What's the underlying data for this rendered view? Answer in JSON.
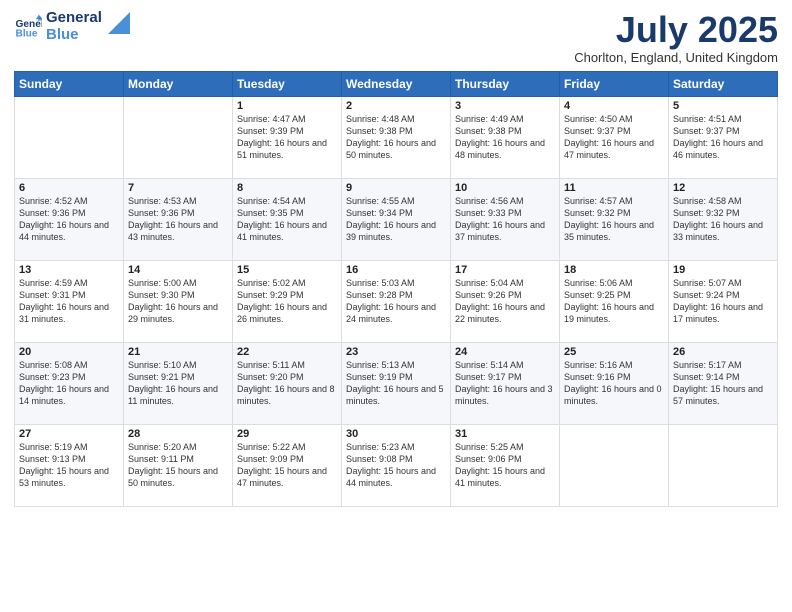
{
  "logo": {
    "line1": "General",
    "line2": "Blue"
  },
  "title": "July 2025",
  "subtitle": "Chorlton, England, United Kingdom",
  "days_of_week": [
    "Sunday",
    "Monday",
    "Tuesday",
    "Wednesday",
    "Thursday",
    "Friday",
    "Saturday"
  ],
  "weeks": [
    [
      {
        "day": "",
        "sunrise": "",
        "sunset": "",
        "daylight": ""
      },
      {
        "day": "",
        "sunrise": "",
        "sunset": "",
        "daylight": ""
      },
      {
        "day": "1",
        "sunrise": "Sunrise: 4:47 AM",
        "sunset": "Sunset: 9:39 PM",
        "daylight": "Daylight: 16 hours and 51 minutes."
      },
      {
        "day": "2",
        "sunrise": "Sunrise: 4:48 AM",
        "sunset": "Sunset: 9:38 PM",
        "daylight": "Daylight: 16 hours and 50 minutes."
      },
      {
        "day": "3",
        "sunrise": "Sunrise: 4:49 AM",
        "sunset": "Sunset: 9:38 PM",
        "daylight": "Daylight: 16 hours and 48 minutes."
      },
      {
        "day": "4",
        "sunrise": "Sunrise: 4:50 AM",
        "sunset": "Sunset: 9:37 PM",
        "daylight": "Daylight: 16 hours and 47 minutes."
      },
      {
        "day": "5",
        "sunrise": "Sunrise: 4:51 AM",
        "sunset": "Sunset: 9:37 PM",
        "daylight": "Daylight: 16 hours and 46 minutes."
      }
    ],
    [
      {
        "day": "6",
        "sunrise": "Sunrise: 4:52 AM",
        "sunset": "Sunset: 9:36 PM",
        "daylight": "Daylight: 16 hours and 44 minutes."
      },
      {
        "day": "7",
        "sunrise": "Sunrise: 4:53 AM",
        "sunset": "Sunset: 9:36 PM",
        "daylight": "Daylight: 16 hours and 43 minutes."
      },
      {
        "day": "8",
        "sunrise": "Sunrise: 4:54 AM",
        "sunset": "Sunset: 9:35 PM",
        "daylight": "Daylight: 16 hours and 41 minutes."
      },
      {
        "day": "9",
        "sunrise": "Sunrise: 4:55 AM",
        "sunset": "Sunset: 9:34 PM",
        "daylight": "Daylight: 16 hours and 39 minutes."
      },
      {
        "day": "10",
        "sunrise": "Sunrise: 4:56 AM",
        "sunset": "Sunset: 9:33 PM",
        "daylight": "Daylight: 16 hours and 37 minutes."
      },
      {
        "day": "11",
        "sunrise": "Sunrise: 4:57 AM",
        "sunset": "Sunset: 9:32 PM",
        "daylight": "Daylight: 16 hours and 35 minutes."
      },
      {
        "day": "12",
        "sunrise": "Sunrise: 4:58 AM",
        "sunset": "Sunset: 9:32 PM",
        "daylight": "Daylight: 16 hours and 33 minutes."
      }
    ],
    [
      {
        "day": "13",
        "sunrise": "Sunrise: 4:59 AM",
        "sunset": "Sunset: 9:31 PM",
        "daylight": "Daylight: 16 hours and 31 minutes."
      },
      {
        "day": "14",
        "sunrise": "Sunrise: 5:00 AM",
        "sunset": "Sunset: 9:30 PM",
        "daylight": "Daylight: 16 hours and 29 minutes."
      },
      {
        "day": "15",
        "sunrise": "Sunrise: 5:02 AM",
        "sunset": "Sunset: 9:29 PM",
        "daylight": "Daylight: 16 hours and 26 minutes."
      },
      {
        "day": "16",
        "sunrise": "Sunrise: 5:03 AM",
        "sunset": "Sunset: 9:28 PM",
        "daylight": "Daylight: 16 hours and 24 minutes."
      },
      {
        "day": "17",
        "sunrise": "Sunrise: 5:04 AM",
        "sunset": "Sunset: 9:26 PM",
        "daylight": "Daylight: 16 hours and 22 minutes."
      },
      {
        "day": "18",
        "sunrise": "Sunrise: 5:06 AM",
        "sunset": "Sunset: 9:25 PM",
        "daylight": "Daylight: 16 hours and 19 minutes."
      },
      {
        "day": "19",
        "sunrise": "Sunrise: 5:07 AM",
        "sunset": "Sunset: 9:24 PM",
        "daylight": "Daylight: 16 hours and 17 minutes."
      }
    ],
    [
      {
        "day": "20",
        "sunrise": "Sunrise: 5:08 AM",
        "sunset": "Sunset: 9:23 PM",
        "daylight": "Daylight: 16 hours and 14 minutes."
      },
      {
        "day": "21",
        "sunrise": "Sunrise: 5:10 AM",
        "sunset": "Sunset: 9:21 PM",
        "daylight": "Daylight: 16 hours and 11 minutes."
      },
      {
        "day": "22",
        "sunrise": "Sunrise: 5:11 AM",
        "sunset": "Sunset: 9:20 PM",
        "daylight": "Daylight: 16 hours and 8 minutes."
      },
      {
        "day": "23",
        "sunrise": "Sunrise: 5:13 AM",
        "sunset": "Sunset: 9:19 PM",
        "daylight": "Daylight: 16 hours and 5 minutes."
      },
      {
        "day": "24",
        "sunrise": "Sunrise: 5:14 AM",
        "sunset": "Sunset: 9:17 PM",
        "daylight": "Daylight: 16 hours and 3 minutes."
      },
      {
        "day": "25",
        "sunrise": "Sunrise: 5:16 AM",
        "sunset": "Sunset: 9:16 PM",
        "daylight": "Daylight: 16 hours and 0 minutes."
      },
      {
        "day": "26",
        "sunrise": "Sunrise: 5:17 AM",
        "sunset": "Sunset: 9:14 PM",
        "daylight": "Daylight: 15 hours and 57 minutes."
      }
    ],
    [
      {
        "day": "27",
        "sunrise": "Sunrise: 5:19 AM",
        "sunset": "Sunset: 9:13 PM",
        "daylight": "Daylight: 15 hours and 53 minutes."
      },
      {
        "day": "28",
        "sunrise": "Sunrise: 5:20 AM",
        "sunset": "Sunset: 9:11 PM",
        "daylight": "Daylight: 15 hours and 50 minutes."
      },
      {
        "day": "29",
        "sunrise": "Sunrise: 5:22 AM",
        "sunset": "Sunset: 9:09 PM",
        "daylight": "Daylight: 15 hours and 47 minutes."
      },
      {
        "day": "30",
        "sunrise": "Sunrise: 5:23 AM",
        "sunset": "Sunset: 9:08 PM",
        "daylight": "Daylight: 15 hours and 44 minutes."
      },
      {
        "day": "31",
        "sunrise": "Sunrise: 5:25 AM",
        "sunset": "Sunset: 9:06 PM",
        "daylight": "Daylight: 15 hours and 41 minutes."
      },
      {
        "day": "",
        "sunrise": "",
        "sunset": "",
        "daylight": ""
      },
      {
        "day": "",
        "sunrise": "",
        "sunset": "",
        "daylight": ""
      }
    ]
  ]
}
